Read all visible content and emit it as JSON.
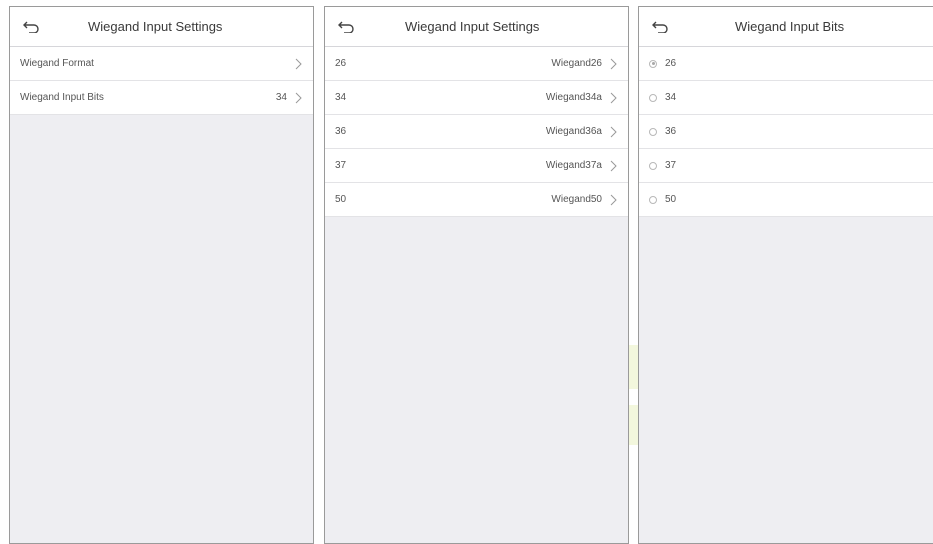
{
  "screen1": {
    "title": "Wiegand Input Settings",
    "rows": [
      {
        "label": "Wiegand Format",
        "value": ""
      },
      {
        "label": "Wiegand Input Bits",
        "value": "34"
      }
    ]
  },
  "screen2": {
    "title": "Wiegand Input Settings",
    "rows": [
      {
        "label": "26",
        "value": "Wiegand26"
      },
      {
        "label": "34",
        "value": "Wiegand34a"
      },
      {
        "label": "36",
        "value": "Wiegand36a"
      },
      {
        "label": "37",
        "value": "Wiegand37a"
      },
      {
        "label": "50",
        "value": "Wiegand50"
      }
    ]
  },
  "screen3": {
    "title": "Wiegand Input Bits",
    "options": [
      {
        "label": "26",
        "selected": true
      },
      {
        "label": "34",
        "selected": false
      },
      {
        "label": "36",
        "selected": false
      },
      {
        "label": "37",
        "selected": false
      },
      {
        "label": "50",
        "selected": false
      }
    ]
  },
  "icons": {
    "back": "back-arrow-icon",
    "chevron": "chevron-right-icon"
  },
  "colors": {
    "background": "#eeeef2",
    "surface": "#ffffff",
    "text": "#3a3a3a"
  }
}
